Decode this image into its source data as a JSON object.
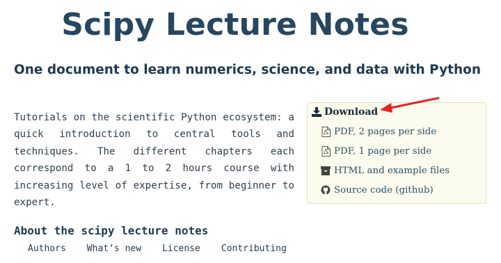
{
  "header": {
    "title": "Scipy Lecture Notes",
    "subtitle": "One document to learn numerics, science, and data with Python"
  },
  "intro": {
    "text": "Tutorials on the scientific Python ecosystem: a quick introduction to central tools and techniques. The different chapters each correspond to a 1 to 2 hours course with increasing level of expertise, from beginner to expert."
  },
  "download": {
    "title": "Download",
    "items": [
      {
        "label": "PDF, 2 pages per side",
        "icon": "pdf-icon"
      },
      {
        "label": "PDF, 1 page per side",
        "icon": "pdf-icon"
      },
      {
        "label": "HTML and example files",
        "icon": "archive-icon"
      },
      {
        "label": "Source code (github)",
        "icon": "github-icon"
      }
    ],
    "colors": {
      "box_bg": "#fcfcee",
      "box_border": "#dfe0bf",
      "arrow": "#e52421"
    }
  },
  "about": {
    "heading": "About the scipy lecture notes",
    "links": [
      "Authors",
      "What’s new",
      "License",
      "Contributing"
    ]
  }
}
